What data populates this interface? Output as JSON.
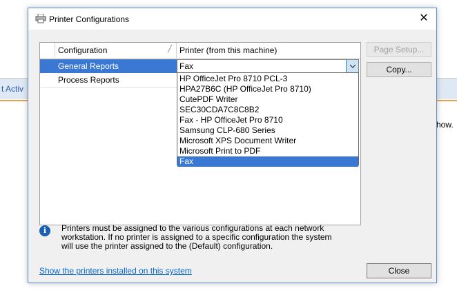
{
  "background": {
    "left_fragment": "t Activ",
    "right_fragment": "how."
  },
  "dialog": {
    "title": "Printer Configurations",
    "title_icon": "printer-icon",
    "close_glyph": "✕"
  },
  "grid": {
    "columns": [
      "Configuration",
      "Printer (from this machine)"
    ],
    "rows": [
      {
        "configuration": "General Reports",
        "selected": true
      },
      {
        "configuration": "Process Reports",
        "selected": false
      }
    ],
    "combo_value": "Fax",
    "dropdown_options": [
      "HP OfficeJet Pro 8710 PCL-3",
      "HPA27B6C (HP OfficeJet Pro 8710)",
      "CutePDF Writer",
      "SEC30CDA7C8C8B2",
      "Fax - HP OfficeJet Pro 8710",
      "Samsung CLP-680 Series",
      "Microsoft XPS Document Writer",
      "Microsoft Print to PDF",
      "Fax"
    ],
    "dropdown_selected": "Fax"
  },
  "buttons": {
    "page_setup": "Page Setup...",
    "copy": "Copy...",
    "close": "Close"
  },
  "info": {
    "lines": [
      "Printers must be assigned to the various configurations at each network",
      "workstation. If no printer is assigned to a specific configuration the system",
      "will use the printer assigned to the (Default) configuration."
    ]
  },
  "link_text": "Show the printers installed on this system",
  "colors": {
    "selection": "#3a78d4",
    "link": "#0066cc",
    "dialog_border": "#5b8ac4"
  }
}
